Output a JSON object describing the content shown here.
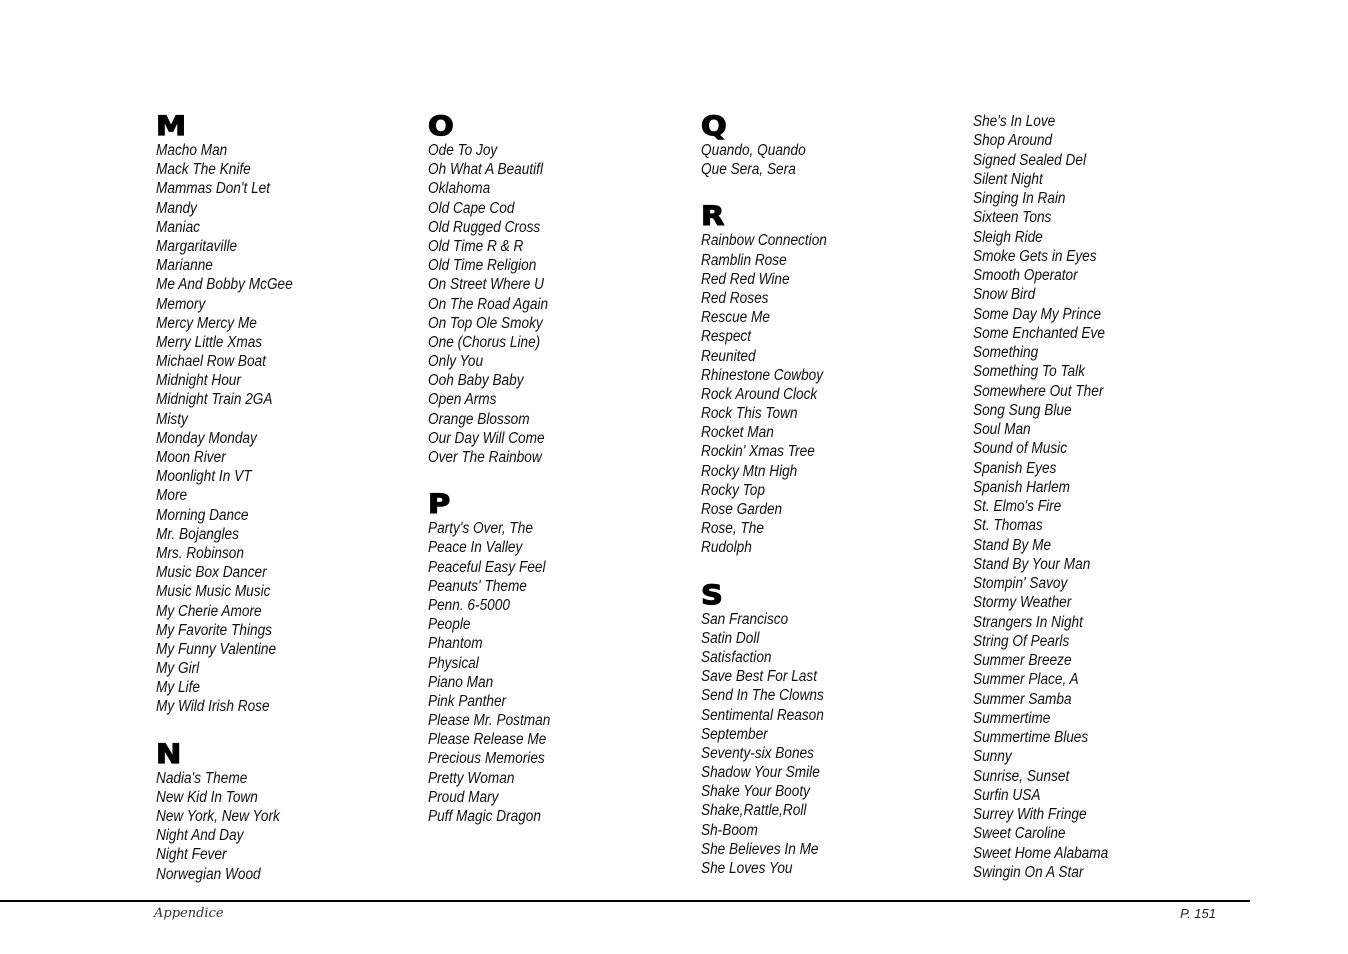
{
  "columns": [
    {
      "sections": [
        {
          "letter": "M",
          "songs": [
            "Macho Man",
            "Mack The Knife",
            "Mammas Don't Let",
            "Mandy",
            "Maniac",
            "Margaritaville",
            "Marianne",
            "Me And Bobby McGee",
            "Memory",
            "Mercy Mercy Me",
            "Merry Little Xmas",
            "Michael Row Boat",
            "Midnight Hour",
            "Midnight Train 2GA",
            "Misty",
            "Monday Monday",
            "Moon River",
            "Moonlight In VT",
            "More",
            "Morning Dance",
            "Mr. Bojangles",
            "Mrs. Robinson",
            "Music Box Dancer",
            "Music Music Music",
            "My Cherie Amore",
            "My Favorite Things",
            "My Funny Valentine",
            "My Girl",
            "My Life",
            "My Wild Irish Rose"
          ]
        },
        {
          "letter": "N",
          "songs": [
            "Nadia's Theme",
            "New Kid In Town",
            "New York, New York",
            "Night And Day",
            "Night Fever",
            "Norwegian Wood"
          ]
        }
      ]
    },
    {
      "sections": [
        {
          "letter": "O",
          "songs": [
            "Ode To Joy",
            "Oh What A Beautifl",
            "Oklahoma",
            "Old Cape Cod",
            "Old Rugged Cross",
            "Old Time R & R",
            "Old Time Religion",
            "On Street Where U",
            "On The Road Again",
            "On Top Ole Smoky",
            "One (Chorus Line)",
            "Only You",
            "Ooh Baby Baby",
            "Open Arms",
            "Orange Blossom",
            "Our Day Will Come",
            "Over The Rainbow"
          ]
        },
        {
          "letter": "P",
          "songs": [
            "Party's Over, The",
            "Peace In Valley",
            "Peaceful Easy Feel",
            "Peanuts' Theme",
            "Penn. 6-5000",
            "People",
            "Phantom",
            "Physical",
            "Piano Man",
            "Pink Panther",
            "Please Mr. Postman",
            "Please Release Me",
            "Precious Memories",
            "Pretty Woman",
            "Proud Mary",
            "Puff Magic Dragon"
          ]
        }
      ]
    },
    {
      "sections": [
        {
          "letter": "Q",
          "songs": [
            "Quando, Quando",
            "Que Sera, Sera"
          ]
        },
        {
          "letter": "R",
          "songs": [
            "Rainbow Connection",
            "Ramblin Rose",
            "Red Red Wine",
            "Red Roses",
            "Rescue Me",
            "Respect",
            "Reunited",
            "Rhinestone Cowboy",
            "Rock Around Clock",
            "Rock This Town",
            "Rocket Man",
            "Rockin' Xmas Tree",
            "Rocky Mtn High",
            "Rocky Top",
            "Rose Garden",
            "Rose, The",
            "Rudolph"
          ]
        },
        {
          "letter": "S",
          "songs": [
            "San Francisco",
            "Satin Doll",
            "Satisfaction",
            "Save Best For Last",
            "Send In The Clowns",
            "Sentimental Reason",
            "September",
            "Seventy-six Bones",
            "Shadow Your Smile",
            "Shake Your Booty",
            "Shake,Rattle,Roll",
            "Sh-Boom",
            "She Believes In Me",
            "She Loves You"
          ]
        }
      ]
    },
    {
      "sections": [
        {
          "letter": "",
          "songs": [
            "She's In Love",
            "Shop Around",
            "Signed Sealed Del",
            "Silent Night",
            "Singing In Rain",
            "Sixteen Tons",
            "Sleigh Ride",
            "Smoke Gets in Eyes",
            "Smooth Operator",
            "Snow Bird",
            "Some Day My Prince",
            "Some Enchanted Eve",
            "Something",
            "Something To Talk",
            "Somewhere Out Ther",
            "Song Sung Blue",
            "Soul Man",
            "Sound of Music",
            "Spanish Eyes",
            "Spanish Harlem",
            "St. Elmo's Fire",
            "St. Thomas",
            "Stand By Me",
            "Stand By Your Man",
            "Stompin' Savoy",
            "Stormy Weather",
            "Strangers In Night",
            "String Of Pearls",
            "Summer Breeze",
            "Summer Place, A",
            "Summer Samba",
            "Summertime",
            "Summertime Blues",
            "Sunny",
            "Sunrise, Sunset",
            "Surfin USA",
            "Surrey With Fringe",
            "Sweet Caroline",
            "Sweet Home Alabama",
            "Swingin On A Star"
          ]
        }
      ]
    }
  ],
  "footer": {
    "section_label": "Appendice",
    "page_number": "P. 151"
  }
}
